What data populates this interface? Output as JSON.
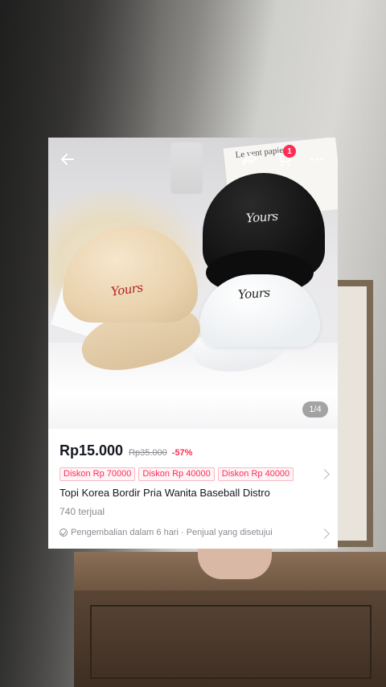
{
  "product": {
    "price": "Rp15.000",
    "original_price": "Rp35.000",
    "discount_percent": "-57%",
    "vouchers": [
      "Diskon Rp 70000",
      "Diskon Rp 40000",
      "Diskon Rp 40000"
    ],
    "title": "Topi Korea Bordir Pria Wanita Baseball Distro",
    "sold": "740 terjual",
    "policy": "Pengembalian dalam 6 hari · Penjual yang disetujui"
  },
  "gallery": {
    "indicator": "1/4",
    "embroidery_text": "Yours",
    "paper_text": "Le vent papier"
  },
  "header": {
    "cart_count": "1",
    "icons": [
      "back-arrow-icon",
      "share-icon",
      "cart-icon",
      "more-icon"
    ]
  },
  "colors": {
    "accent": "#fe2c55",
    "text_primary": "#161823",
    "text_secondary": "#8a8b91"
  }
}
